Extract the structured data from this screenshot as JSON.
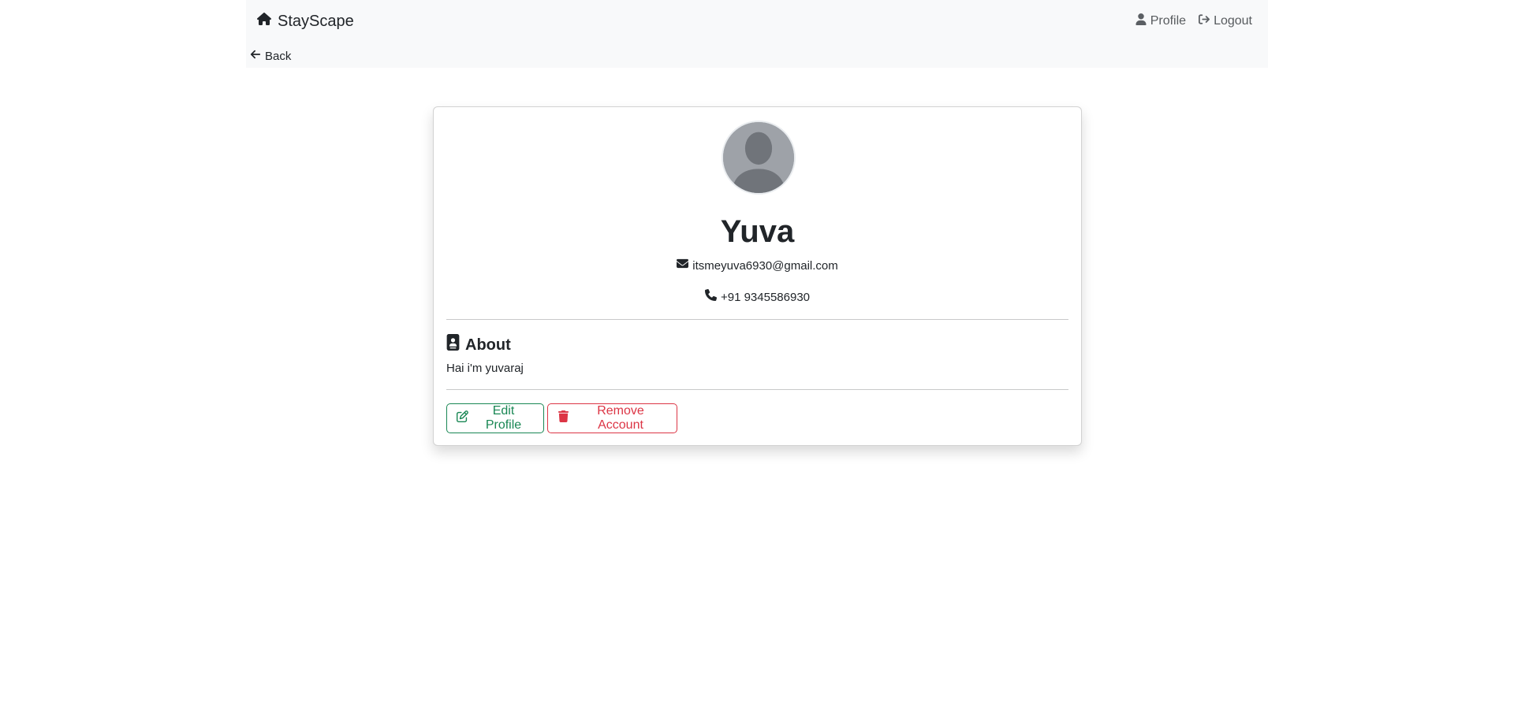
{
  "navbar": {
    "brand": "StayScape",
    "brand_icon": "home-icon",
    "links": [
      {
        "label": "Profile",
        "icon": "user-icon"
      },
      {
        "label": "Logout",
        "icon": "logout-icon"
      }
    ],
    "back_label": "Back"
  },
  "profile": {
    "name": "Yuva",
    "email": "itsmeyuva6930@gmail.com",
    "phone": "+91 9345586930",
    "about_heading": "About",
    "about_text": "Hai i'm yuvaraj"
  },
  "actions": {
    "edit_label": "Edit Profile",
    "remove_label": "Remove Account"
  },
  "colors": {
    "navbar_bg": "#f8f9fa",
    "success": "#198754",
    "danger": "#dc3545",
    "text": "#212529"
  }
}
